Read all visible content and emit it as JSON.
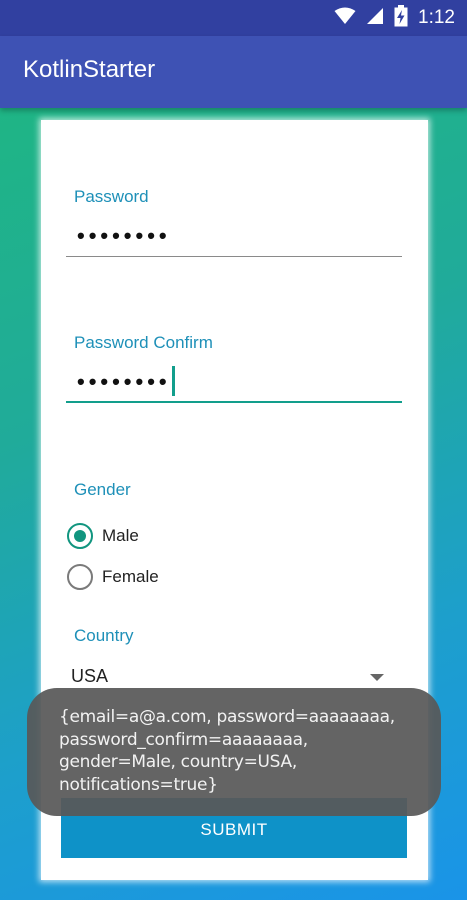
{
  "status_bar": {
    "time": "1:12",
    "icons": [
      "wifi-icon",
      "signal-icon",
      "battery-charging-icon"
    ]
  },
  "app_bar": {
    "title": "KotlinStarter"
  },
  "form": {
    "password": {
      "label": "Password",
      "value": "••••••••"
    },
    "password_confirm": {
      "label": "Password Confirm",
      "value": "••••••••"
    },
    "gender": {
      "label": "Gender",
      "options": [
        {
          "label": "Male",
          "checked": true
        },
        {
          "label": "Female",
          "checked": false
        }
      ]
    },
    "country": {
      "label": "Country",
      "selected": "USA"
    },
    "submit_label": "SUBMIT"
  },
  "toast": {
    "message": "{email=a@a.com, password=aaaaaaaa, password_confirm=aaaaaaaa, gender=Male, country=USA, notifications=true}"
  },
  "colors": {
    "status_bar": "#3140a0",
    "app_bar": "#3e52b4",
    "accent": "#11957f",
    "label": "#1e90b8",
    "button": "#0e92c8",
    "gradient_start": "#1fb585",
    "gradient_end": "#1a94e8"
  }
}
